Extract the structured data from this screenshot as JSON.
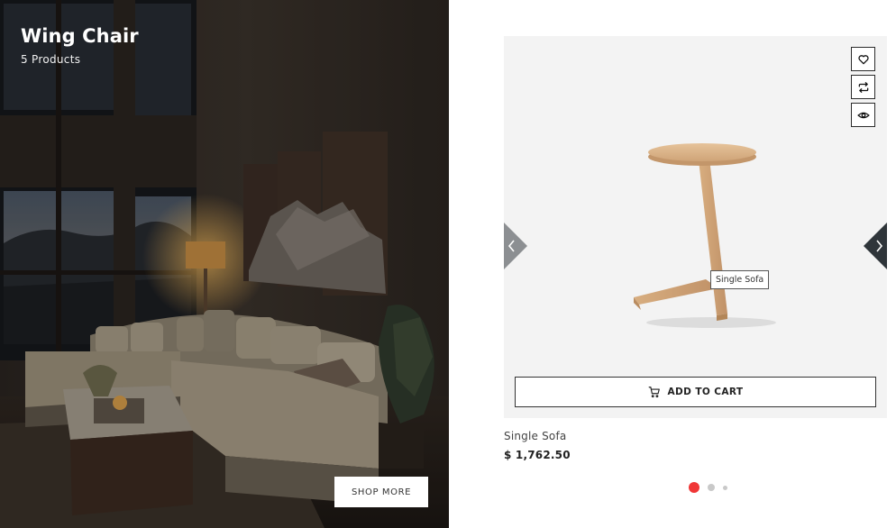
{
  "collection": {
    "title": "Wing Chair",
    "count_label": "5 Products",
    "cta_label": "SHOP MORE"
  },
  "product": {
    "name": "Single Sofa",
    "price": "$ 1,762.50",
    "tooltip": "Single Sofa",
    "add_to_cart_label": "ADD TO CART",
    "actions": [
      "heart-icon",
      "compare-icon",
      "eye-icon"
    ]
  },
  "carousel": {
    "dots": 3,
    "active_index": 0
  },
  "colors": {
    "accent": "#f03737",
    "dot_inactive": "#c9c9c9",
    "card_bg": "#f3f3f3",
    "nav_arrow": "#2f353a"
  }
}
